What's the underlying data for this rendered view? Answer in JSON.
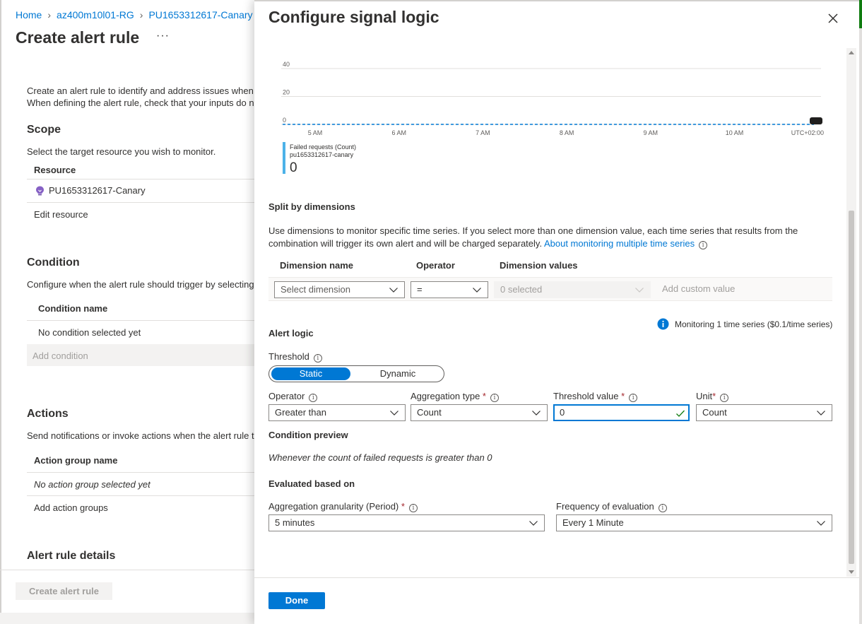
{
  "breadcrumb": [
    "Home",
    "az400m10l01-RG",
    "PU1653312617-Canary"
  ],
  "background": {
    "title": "Create alert rule",
    "more": "···",
    "intro_line1": "Create an alert rule to identify and address issues when i",
    "intro_line2": "When defining the alert rule, check that your inputs do n",
    "scope_title": "Scope",
    "scope_desc": "Select the target resource you wish to monitor.",
    "resource_header": "Resource",
    "resource_name": "PU1653312617-Canary",
    "edit_resource": "Edit resource",
    "condition_title": "Condition",
    "condition_desc": "Configure when the alert rule should trigger by selecting",
    "condition_header": "Condition name",
    "condition_empty": "No condition selected yet",
    "add_condition": "Add condition",
    "actions_title": "Actions",
    "actions_desc": "Send notifications or invoke actions when the alert rule t",
    "action_group_header": "Action group name",
    "action_group_empty": "No action group selected yet",
    "add_action_groups": "Add action groups",
    "details_title": "Alert rule details",
    "create_button": "Create alert rule"
  },
  "panel": {
    "title": "Configure signal logic",
    "legend": {
      "name_line1": "Failed requests (Count)",
      "name_line2": "pu1653312617-canary",
      "value": "0"
    },
    "split_title": "Split by dimensions",
    "split_desc": "Use dimensions to monitor specific time series. If you select more than one dimension value, each time series that results from the combination will trigger its own alert and will be charged separately.",
    "split_link": "About monitoring multiple time series",
    "dim_headers": {
      "name": "Dimension name",
      "operator": "Operator",
      "values": "Dimension values"
    },
    "dim_row": {
      "dimension_placeholder": "Select dimension",
      "operator": "=",
      "values": "0 selected",
      "custom": "Add custom value"
    },
    "monitoring_text": "Monitoring 1 time series ($0.1/time series)",
    "alert_logic_title": "Alert logic",
    "threshold_label": "Threshold",
    "threshold_static": "Static",
    "threshold_dynamic": "Dynamic",
    "operator_label": "Operator",
    "operator_value": "Greater than",
    "aggregation_label": "Aggregation type",
    "aggregation_value": "Count",
    "threshold_value_label": "Threshold value",
    "threshold_value": "0",
    "unit_label": "Unit",
    "unit_value": "Count",
    "condition_preview_title": "Condition preview",
    "condition_preview_text": "Whenever the count of failed requests is greater than 0",
    "evaluated_title": "Evaluated based on",
    "granularity_label": "Aggregation granularity (Period)",
    "granularity_value": "5 minutes",
    "frequency_label": "Frequency of evaluation",
    "frequency_value": "Every 1 Minute",
    "done_label": "Done"
  },
  "chart_data": {
    "type": "line",
    "x": [
      "5 AM",
      "6 AM",
      "7 AM",
      "8 AM",
      "9 AM",
      "10 AM"
    ],
    "x_suffix": "UTC+02:00",
    "yticks": [
      "0",
      "20",
      "40"
    ],
    "ylim": [
      0,
      40
    ],
    "series": [
      {
        "name": "Failed requests (Count)",
        "values": [
          0,
          0,
          0,
          0,
          0,
          0
        ]
      }
    ],
    "grid": true,
    "colors": {
      "line": "#0078d4",
      "grid": "#e1dfdd"
    }
  }
}
